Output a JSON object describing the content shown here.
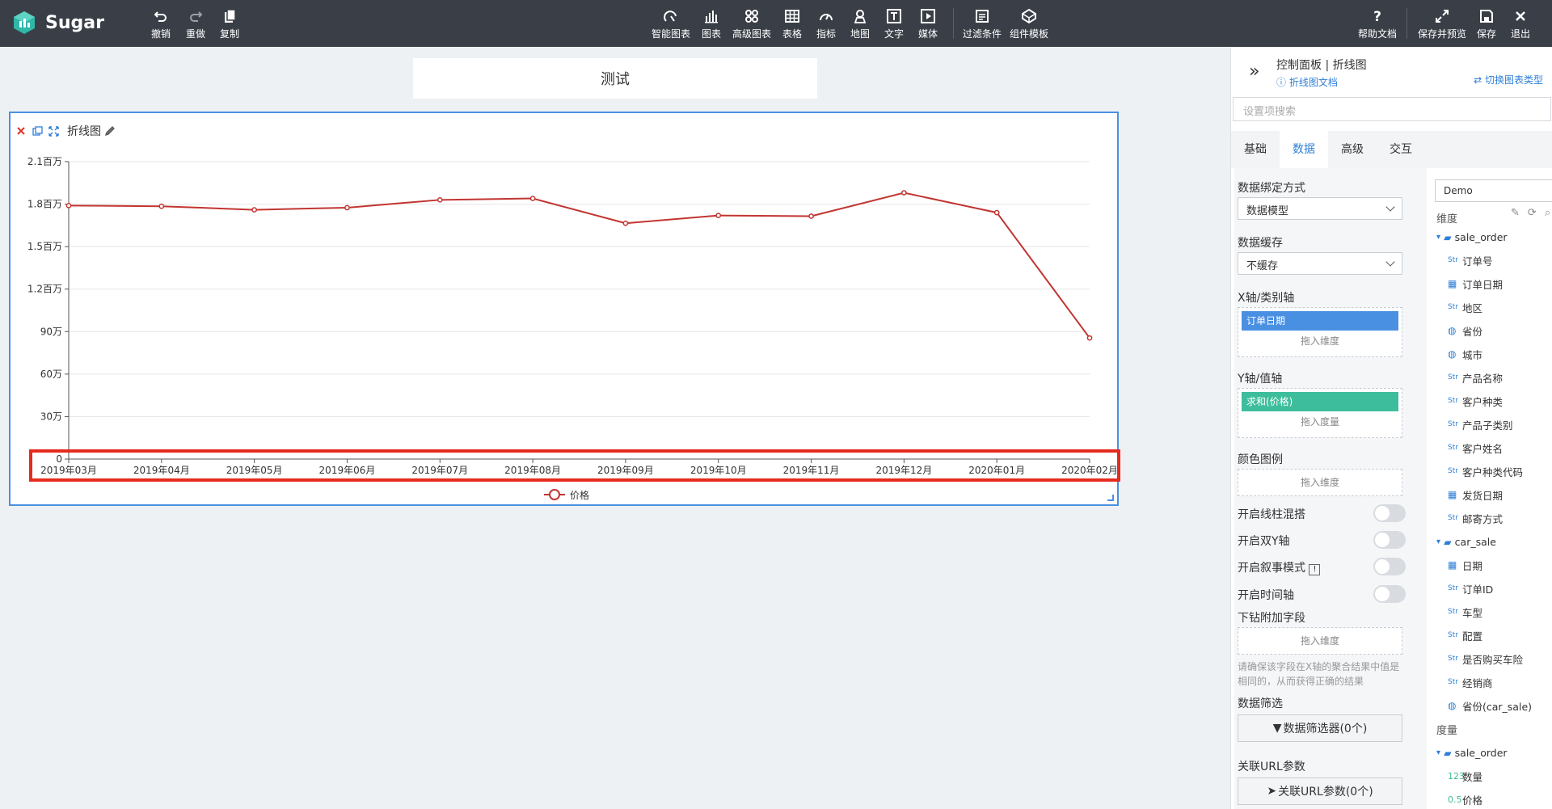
{
  "app": {
    "name": "Sugar"
  },
  "toolbar": {
    "undo": "撤销",
    "redo": "重做",
    "copy": "复制",
    "smart_chart": "智能图表",
    "chart": "图表",
    "advanced_chart": "高级图表",
    "table": "表格",
    "indicator": "指标",
    "map": "地图",
    "text": "文字",
    "media": "媒体",
    "filter": "过滤条件",
    "component_template": "组件模板",
    "help": "帮助文档",
    "save_preview": "保存并预览",
    "save": "保存",
    "exit": "退出"
  },
  "canvas": {
    "title": "测试",
    "card_title": "折线图"
  },
  "chart_data": {
    "type": "line",
    "categories": [
      "2019年03月",
      "2019年04月",
      "2019年05月",
      "2019年06月",
      "2019年07月",
      "2019年08月",
      "2019年09月",
      "2019年10月",
      "2019年11月",
      "2019年12月",
      "2020年01月",
      "2020年02月"
    ],
    "series": [
      {
        "name": "价格",
        "values": [
          1790000,
          1785000,
          1760000,
          1775000,
          1830000,
          1840000,
          1665000,
          1720000,
          1715000,
          1880000,
          1740000,
          855000
        ],
        "color": "#c23531"
      }
    ],
    "y_ticks": [
      "0",
      "30万",
      "60万",
      "90万",
      "1.2百万",
      "1.5百万",
      "1.8百万",
      "2.1百万"
    ],
    "ylim": [
      0,
      2100000
    ],
    "legend_position": "bottom-center",
    "grid": true
  },
  "panel": {
    "title": "控制面板 | 折线图",
    "doc_link": "折线图文档",
    "switch_link": "切换图表类型",
    "search_placeholder": "设置项搜索",
    "tabs": [
      "基础",
      "数据",
      "高级",
      "交互"
    ],
    "active_tab": "数据",
    "binding_label": "数据绑定方式",
    "binding_value": "数据模型",
    "cache_label": "数据缓存",
    "cache_value": "不缓存",
    "x_axis_label": "X轴/类别轴",
    "x_axis_chip": "订单日期",
    "drop_dimension": "拖入维度",
    "y_axis_label": "Y轴/值轴",
    "y_axis_chip": "求和(价格)",
    "drop_measure": "拖入度量",
    "color_legend_label": "颜色图例",
    "line_bar_mix": "开启线柱混搭",
    "dual_y": "开启双Y轴",
    "narrative": "开启叙事模式",
    "time_axis": "开启时间轴",
    "drill_label": "下钻附加字段",
    "drill_note": "请确保该字段在X轴的聚合结果中值是相同的，从而获得正确的结果",
    "filter_label": "数据筛选",
    "filter_button": "数据筛选器(0个)",
    "url_label": "关联URL参数",
    "url_button": "关联URL参数(0个)"
  },
  "fields": {
    "datasource": "Demo",
    "dimension_label": "维度",
    "measure_label": "度量",
    "groups": [
      {
        "name": "sale_order",
        "items": [
          {
            "type": "Str",
            "name": "订单号"
          },
          {
            "type": "date",
            "name": "订单日期"
          },
          {
            "type": "Str",
            "name": "地区"
          },
          {
            "type": "geo",
            "name": "省份"
          },
          {
            "type": "geo",
            "name": "城市"
          },
          {
            "type": "Str",
            "name": "产品名称"
          },
          {
            "type": "Str",
            "name": "客户种类"
          },
          {
            "type": "Str",
            "name": "产品子类别"
          },
          {
            "type": "Str",
            "name": "客户姓名"
          },
          {
            "type": "Str",
            "name": "客户种类代码"
          },
          {
            "type": "date",
            "name": "发货日期"
          },
          {
            "type": "Str",
            "name": "邮寄方式"
          }
        ]
      },
      {
        "name": "car_sale",
        "items": [
          {
            "type": "date",
            "name": "日期"
          },
          {
            "type": "Str",
            "name": "订单ID"
          },
          {
            "type": "Str",
            "name": "车型"
          },
          {
            "type": "Str",
            "name": "配置"
          },
          {
            "type": "Str",
            "name": "是否购买车险"
          },
          {
            "type": "Str",
            "name": "经销商"
          },
          {
            "type": "geo",
            "name": "省份(car_sale)"
          }
        ]
      }
    ],
    "measure_group": "sale_order",
    "measures": [
      {
        "type": "123",
        "name": "数量"
      },
      {
        "type": "0.5",
        "name": "价格"
      }
    ]
  }
}
